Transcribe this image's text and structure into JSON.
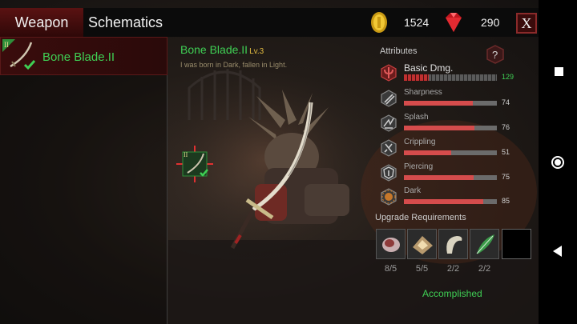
{
  "tabs": {
    "weapon": "Weapon",
    "schematics": "Schematics"
  },
  "currency": {
    "gold": "1524",
    "gems": "290"
  },
  "close_label": "X",
  "weapon_list": [
    {
      "badge": "II",
      "name": "Bone Blade.II"
    }
  ],
  "weapon": {
    "name": "Bone Blade.II",
    "level": "Lv.3",
    "description": "I was born in Dark, fallen in Light.",
    "marker_badge": "II"
  },
  "attributes": {
    "title": "Attributes",
    "help": "?",
    "items": [
      {
        "label": "Basic Dmg.",
        "value": "129",
        "level": 0.27,
        "icon": "trident-icon"
      },
      {
        "label": "Sharpness",
        "value": "74",
        "level": 0.74,
        "icon": "slash-icon"
      },
      {
        "label": "Splash",
        "value": "76",
        "level": 0.76,
        "icon": "splash-icon"
      },
      {
        "label": "Crippling",
        "value": "51",
        "level": 0.51,
        "icon": "crippling-icon"
      },
      {
        "label": "Piercing",
        "value": "75",
        "level": 0.75,
        "icon": "piercing-shield-icon"
      },
      {
        "label": "Dark",
        "value": "85",
        "level": 0.85,
        "icon": "dark-sun-icon"
      }
    ]
  },
  "upgrade": {
    "title": "Upgrade Requirements",
    "items": [
      {
        "count": "8/5",
        "icon": "bone-material-icon"
      },
      {
        "count": "5/5",
        "icon": "crystal-ore-icon"
      },
      {
        "count": "2/2",
        "icon": "sickle-blade-icon"
      },
      {
        "count": "2/2",
        "icon": "green-feather-icon"
      }
    ],
    "status": "Accomplished"
  },
  "colors": {
    "accent_green": "#3fcf54",
    "bar_red": "#d54c4c",
    "tab_active": "#5a1212"
  }
}
